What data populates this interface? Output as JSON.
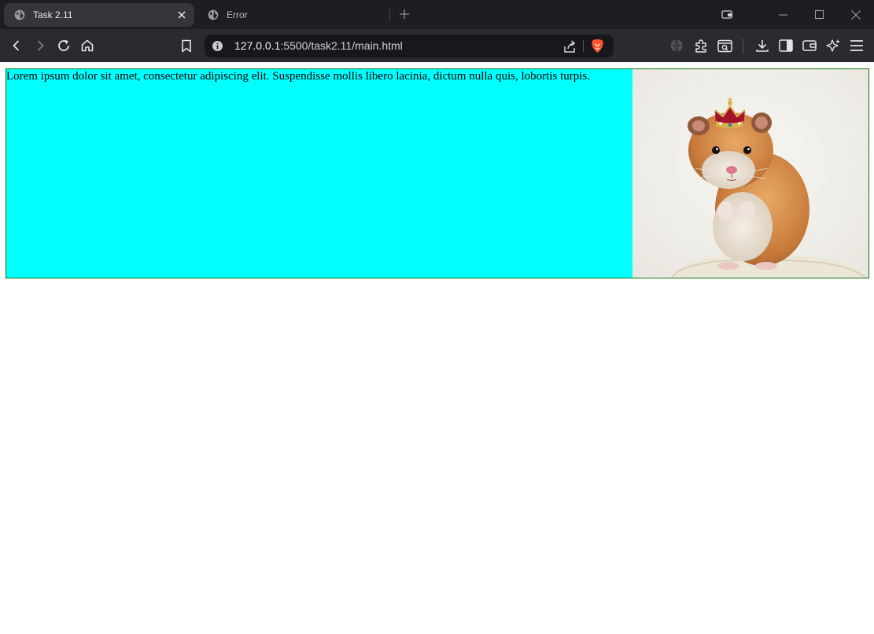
{
  "tabs": [
    {
      "title": "Task 2.11",
      "active": true,
      "icon": "globe-icon"
    },
    {
      "title": "Error",
      "active": false,
      "icon": "globe-icon"
    }
  ],
  "address_bar": {
    "host": "127.0.0.1",
    "port_path": ":5500/task2.11/main.html"
  },
  "page": {
    "paragraph": "Lorem ipsum dolor sit amet, consectetur adipiscing elit. Suspendisse mollis libero lacinia, dictum nulla quis, lobortis turpis.",
    "image_subject": "hamster wearing a crown",
    "text_bg": "#00ffff",
    "border_color": "#0a7a0a"
  },
  "colors": {
    "tabstrip": "#1e1d22",
    "toolbar": "#2b2a30",
    "urlbar": "#18171b",
    "brave": "#fb542b"
  }
}
